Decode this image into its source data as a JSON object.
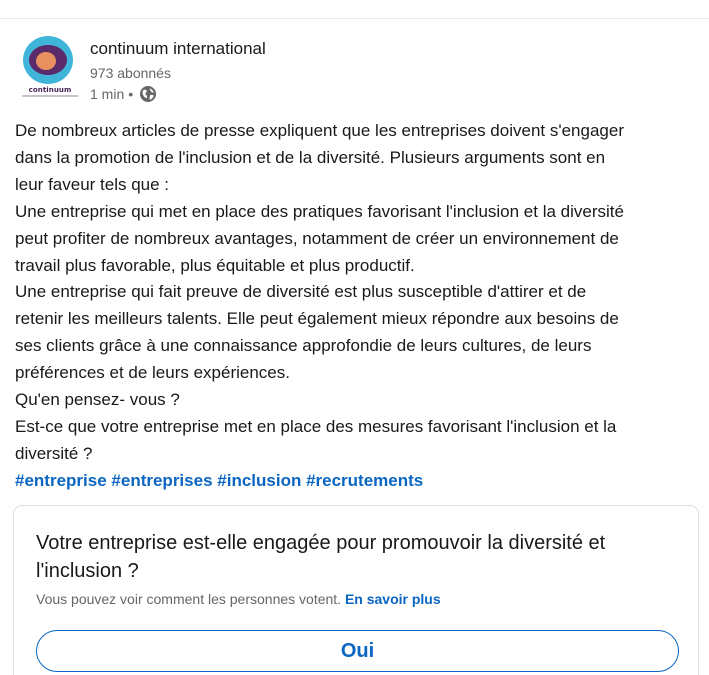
{
  "colors": {
    "link": "#0a66c2",
    "text": "#191919",
    "muted": "#666666",
    "avatar_ring": "#5b2a6b",
    "avatar_fill": "#e9915e",
    "avatar_bg": "#3fb6d9"
  },
  "post": {
    "author": {
      "name": "continuum international",
      "logo_text": "continuum",
      "avatar_icon": "company-logo-icon"
    },
    "followers": "973 abonnés",
    "time": "1 min",
    "separator": "•",
    "visibility_icon": "globe-icon",
    "text_lines": [
      "De nombreux articles de presse expliquent que les entreprises doivent s'engager",
      "dans la promotion de l'inclusion et de la diversité. Plusieurs arguments sont en",
      "leur faveur tels que :",
      "Une entreprise qui met en place des pratiques favorisant l'inclusion et la diversité",
      "peut profiter de nombreux avantages, notamment de créer un environnement de",
      "travail plus favorable, plus équitable et plus productif.",
      "Une entreprise qui fait preuve de diversité est plus susceptible d'attirer et de",
      "retenir les meilleurs talents. Elle peut également mieux répondre aux besoins de",
      "ses clients grâce à une connaissance approfondie de leurs cultures, de leurs",
      "préférences et de leurs expériences.",
      "Qu'en pensez- vous ?",
      "Est-ce que votre entreprise met en place des mesures favorisant l'inclusion et la",
      "diversité ?"
    ],
    "hashtags": [
      "#entreprise",
      "#entreprises",
      "#inclusion",
      "#recrutements"
    ]
  },
  "poll": {
    "question_lines": [
      "Votre entreprise est-elle engagée pour promouvoir la diversité et",
      "l'inclusion ?"
    ],
    "note": "Vous pouvez voir comment les personnes votent.",
    "learn_more": "En savoir plus",
    "options": [
      "Oui"
    ]
  }
}
